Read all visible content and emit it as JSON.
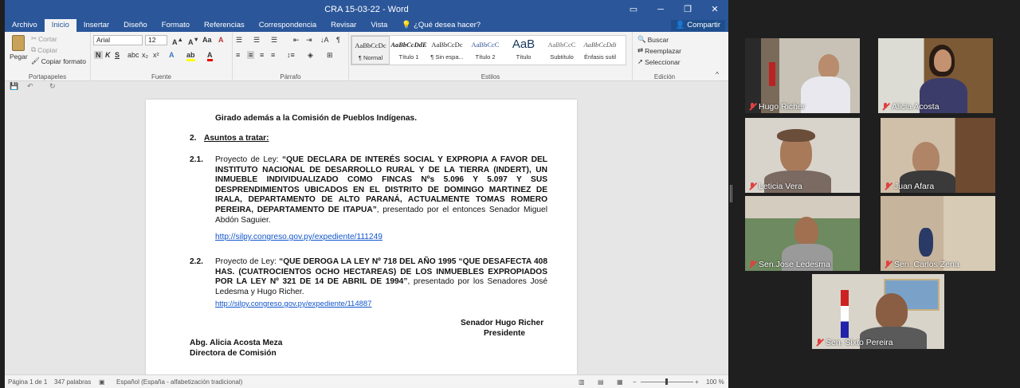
{
  "window": {
    "title": "CRA 15-03-22 - Word"
  },
  "tabs": [
    "Archivo",
    "Inicio",
    "Insertar",
    "Diseño",
    "Formato",
    "Referencias",
    "Correspondencia",
    "Revisar",
    "Vista"
  ],
  "tellme": "¿Qué desea hacer?",
  "share_label": "Compartir",
  "ribbon": {
    "clipboard": {
      "paste": "Pegar",
      "cut": "Cortar",
      "copy": "Copiar",
      "format_painter": "Copiar formato",
      "label": "Portapapeles"
    },
    "font": {
      "name": "Arial",
      "size": "12",
      "label": "Fuente"
    },
    "paragraph": {
      "label": "Párrafo"
    },
    "styles": {
      "label": "Estilos",
      "items": [
        {
          "preview": "AaBbCcDc",
          "name": "¶ Normal"
        },
        {
          "preview": "AaBbCcDdE",
          "name": "Título 1"
        },
        {
          "preview": "AaBbCcDc",
          "name": "¶ Sin espa..."
        },
        {
          "preview": "AaBbCcC",
          "name": "Título 2"
        },
        {
          "preview": "AaB",
          "name": "Título"
        },
        {
          "preview": "AaBbCcC",
          "name": "Subtítulo"
        },
        {
          "preview": "AaBbCcDdi",
          "name": "Énfasis sutil"
        }
      ]
    },
    "editing": {
      "find": "Buscar",
      "replace": "Reemplazar",
      "select": "Seleccionar",
      "label": "Edición"
    }
  },
  "document": {
    "line1": "Girado además a la Comisión de Pueblos Indígenas.",
    "section2_num": "2.",
    "section2_title": "Asuntos a tratar:",
    "item21_num": "2.1.",
    "item21_prefix": "Proyecto de Ley: ",
    "item21_bold": "“QUE DECLARA DE INTERÉS SOCIAL Y EXPROPIA A FAVOR DEL INSTITUTO NACIONAL DE DESARROLLO RURAL Y DE LA TIERRA (INDERT), UN INMUEBLE INDIVIDUALIZADO COMO FINCAS Nºs 5.096 Y 5.097 Y SUS DESPRENDIMIENTOS UBICADOS EN EL DISTRITO DE DOMINGO MARTINEZ DE IRALA, DEPARTAMENTO DE ALTO PARANÁ, ACTUALMENTE TOMAS ROMERO PEREIRA, DEPARTAMENTO DE ITAPUA”",
    "item21_suffix": ", presentado por el entonces Senador Miguel Abdón Saguier.",
    "item21_link": "http://silpy.congreso.gov.py/expediente/111249",
    "item22_num": "2.2.",
    "item22_prefix": "Proyecto de Ley: ",
    "item22_bold": "“QUE DEROGA LA LEY Nº 718 DEL AÑO 1995 “QUE DESAFECTA 408 HAS. (CUATROCIENTOS OCHO HECTAREAS) DE LOS INMUEBLES EXPROPIADOS POR LA LEY Nº 321 DE 14 DE ABRIL DE 1994”",
    "item22_suffix": ", presentado por los Senadores José Ledesma y Hugo Richer.",
    "item22_link": "http://silpy.congreso.gov.py/expediente/114887",
    "sign_name": "Senador Hugo Richer",
    "sign_title": "Presidente",
    "director_name": "Abg. Alicia Acosta Meza",
    "director_title": "Directora de Comisión"
  },
  "status": {
    "page": "Página 1 de 1",
    "words": "347 palabras",
    "language": "Español (España - alfabetización tradicional)",
    "zoom": "100 %"
  },
  "participants": [
    {
      "name": "Hugo Richer"
    },
    {
      "name": "Alicia Acosta"
    },
    {
      "name": "Leticia Vera"
    },
    {
      "name": "Juan Afara"
    },
    {
      "name": "Sen.Jose Ledesma"
    },
    {
      "name": "Sen. Carlos Zena"
    },
    {
      "name": "Sen. Sixto Pereira"
    }
  ],
  "colors": {
    "word_blue": "#2b579a",
    "active_speaker": "#c9e265",
    "link": "#1155cc"
  }
}
